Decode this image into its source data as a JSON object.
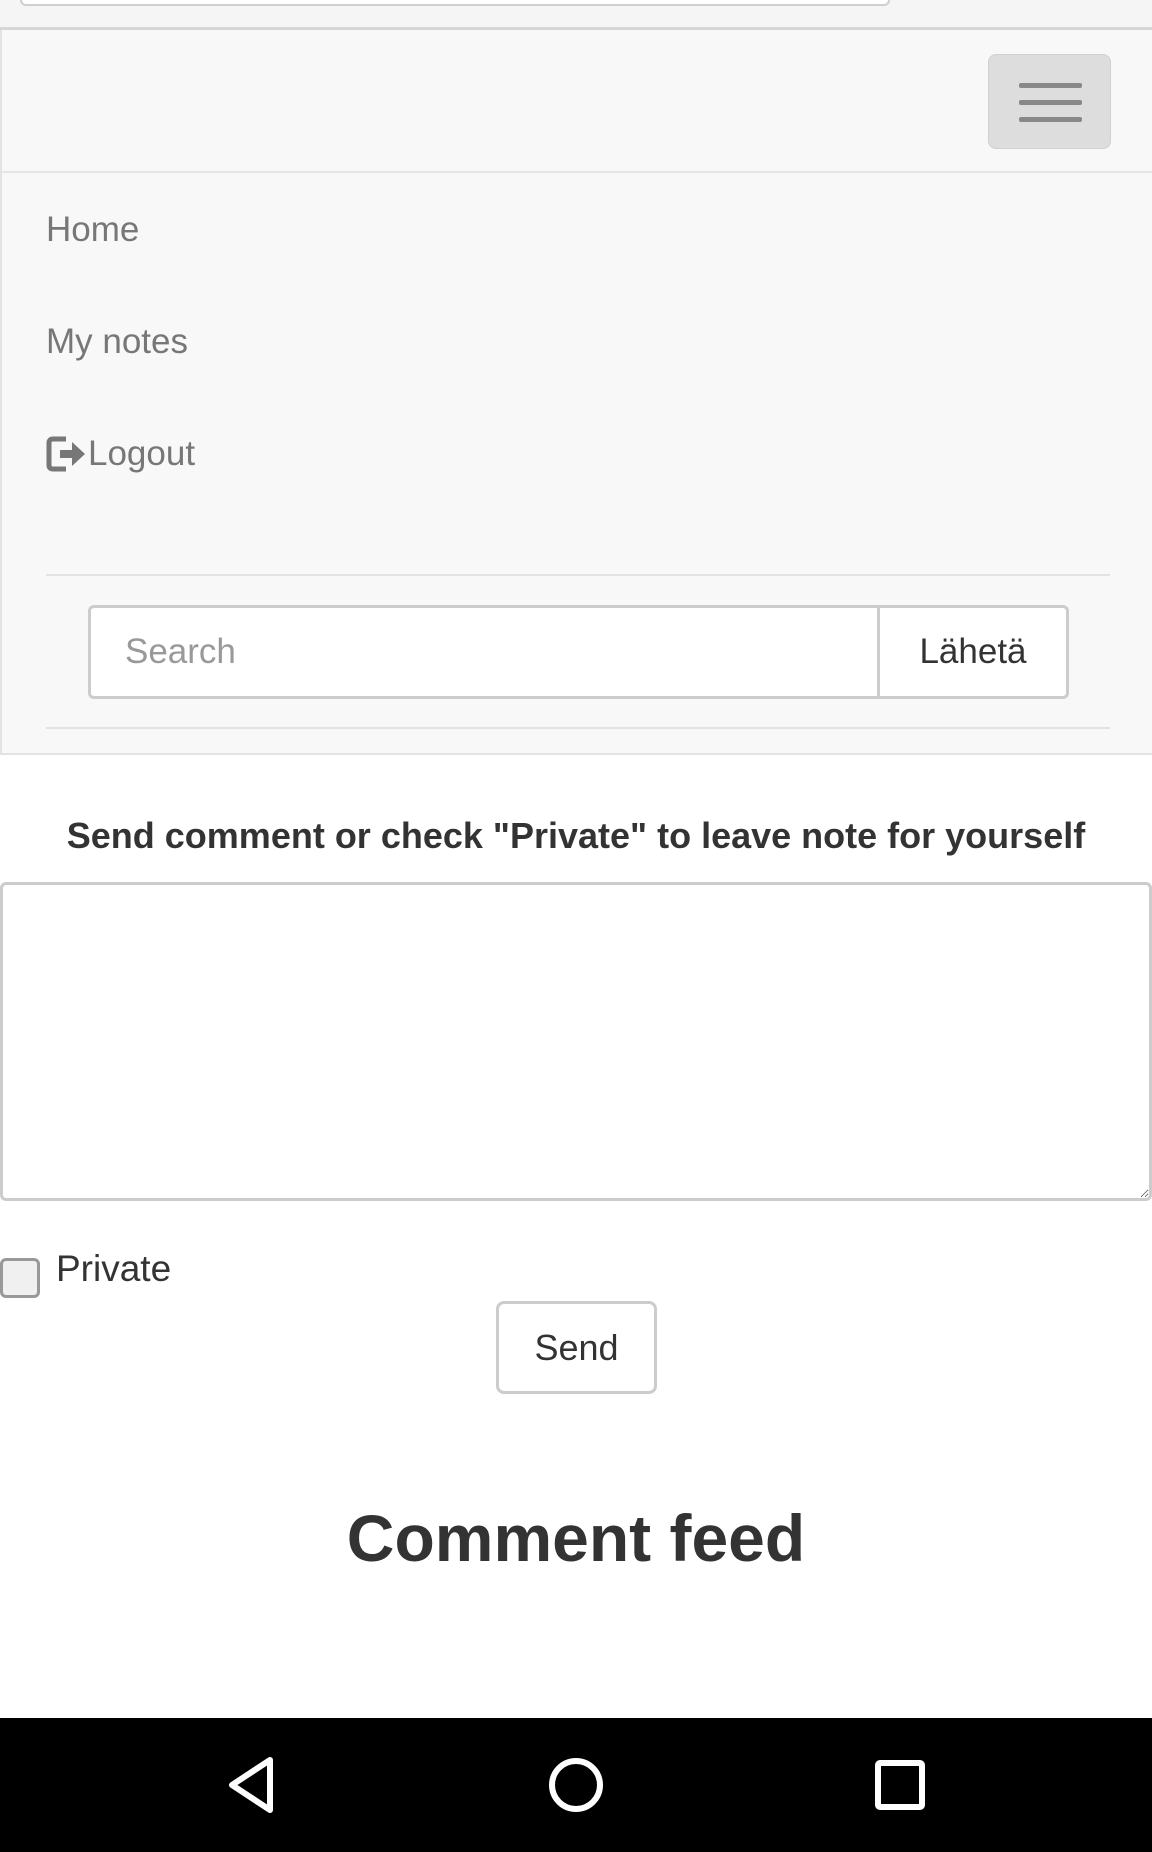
{
  "navbar": {
    "toggle_label": "Toggle navigation",
    "items": [
      {
        "label": "Home"
      },
      {
        "label": "My notes"
      },
      {
        "label": "Logout",
        "icon": "logout-icon"
      }
    ]
  },
  "search": {
    "placeholder": "Search",
    "value": "",
    "button_label": "Lähetä"
  },
  "comment_form": {
    "label": "Send comment or check \"Private\" to leave note for yourself",
    "textarea_value": "",
    "private_label": "Private",
    "private_checked": false,
    "send_label": "Send"
  },
  "feed": {
    "title": "Comment feed"
  },
  "system_nav": {
    "back_icon": "back-triangle-icon",
    "home_icon": "home-circle-icon",
    "recents_icon": "recents-square-icon"
  },
  "colors": {
    "navbar_bg": "#f8f8f8",
    "nav_link": "#777777",
    "text": "#333333",
    "border": "#cccccc",
    "system_bar": "#000000"
  }
}
